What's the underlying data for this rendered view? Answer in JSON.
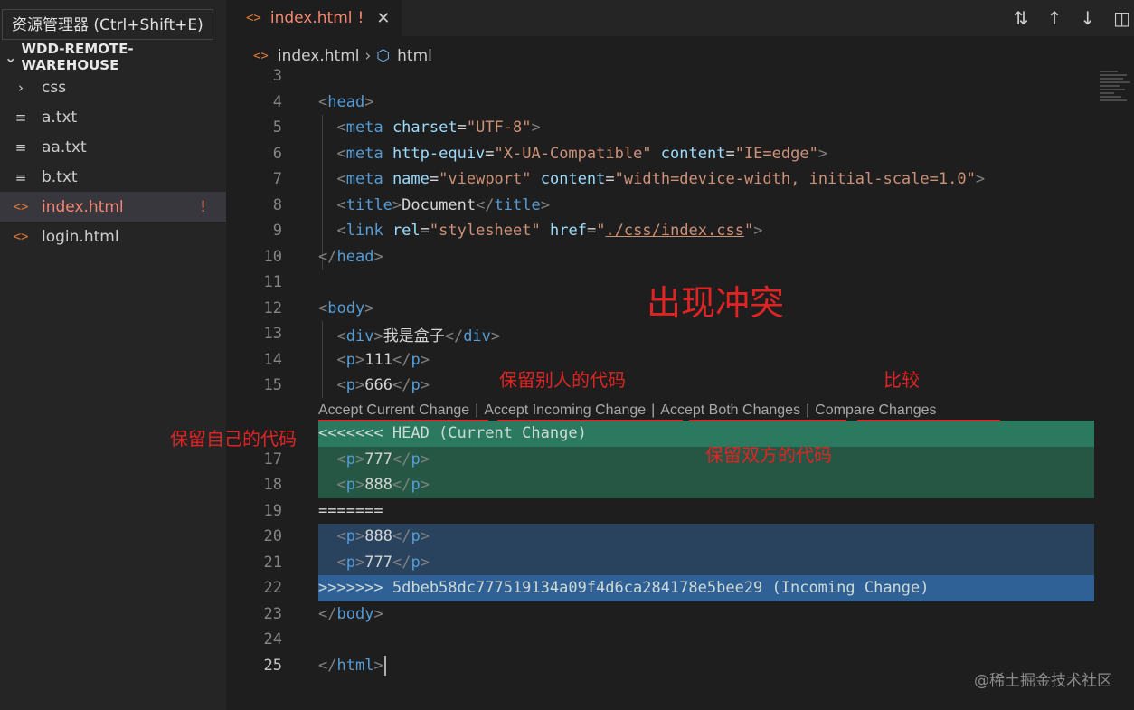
{
  "sidebar": {
    "tooltip": "资源管理器 (Ctrl+Shift+E)",
    "section_title": "WDD-REMOTE-WAREHOUSE",
    "items": [
      {
        "label": "css",
        "icon": "chevron-right-icon"
      },
      {
        "label": "a.txt",
        "icon": "text-file-icon"
      },
      {
        "label": "aa.txt",
        "icon": "text-file-icon"
      },
      {
        "label": "b.txt",
        "icon": "text-file-icon"
      },
      {
        "label": "index.html",
        "icon": "html-file-icon",
        "badge": "!"
      },
      {
        "label": "login.html",
        "icon": "html-file-icon"
      }
    ]
  },
  "tab": {
    "label": "index.html",
    "badge": "!",
    "close": "✕"
  },
  "breadcrumb": {
    "file": "index.html",
    "symbol": "html"
  },
  "editor": {
    "line_numbers": [
      "3",
      "4",
      "5",
      "6",
      "7",
      "8",
      "9",
      "10",
      "11",
      "12",
      "13",
      "14",
      "15",
      "17",
      "18",
      "19",
      "20",
      "21",
      "22",
      "23",
      "24",
      "25"
    ],
    "code": {
      "head_open": "head",
      "meta1_attr": "charset",
      "meta1_val": "\"UTF-8\"",
      "meta2_attr1": "http-equiv",
      "meta2_val1": "\"X-UA-Compatible\"",
      "meta2_attr2": "content",
      "meta2_val2": "\"IE=edge\"",
      "meta3_attr1": "name",
      "meta3_val1": "\"viewport\"",
      "meta3_attr2": "content",
      "meta3_val2": "\"width=device-width, initial-scale=1.0\"",
      "title_text": "Document",
      "link_attr1": "rel",
      "link_val1": "\"stylesheet\"",
      "link_attr2": "href",
      "link_href": "./css/index.css",
      "div_text": "我是盒子",
      "p1": "111",
      "p2": "666",
      "current_marker": "<<<<<<< HEAD (Current Change)",
      "p3": "777",
      "p4": "888",
      "separator": "=======",
      "p5": "888",
      "p6": "777",
      "incoming_marker": ">>>>>>> 5dbeb58dc777519134a09f4d6ca284178e5bee29 (Incoming Change)"
    },
    "codelens": {
      "accept_current": "Accept Current Change",
      "accept_incoming": "Accept Incoming Change",
      "accept_both": "Accept Both Changes",
      "compare": "Compare Changes",
      "separator": "|"
    }
  },
  "annotations": {
    "conflict": "出现冲突",
    "keep_others": "保留别人的代码",
    "compare": "比较",
    "keep_mine": "保留自己的代码",
    "keep_both": "保留双方的代码"
  },
  "watermark": "@稀土掘金技术社区",
  "colors": {
    "conflict_current": "#265745",
    "conflict_incoming": "#29435f",
    "annotation": "#e02424"
  }
}
